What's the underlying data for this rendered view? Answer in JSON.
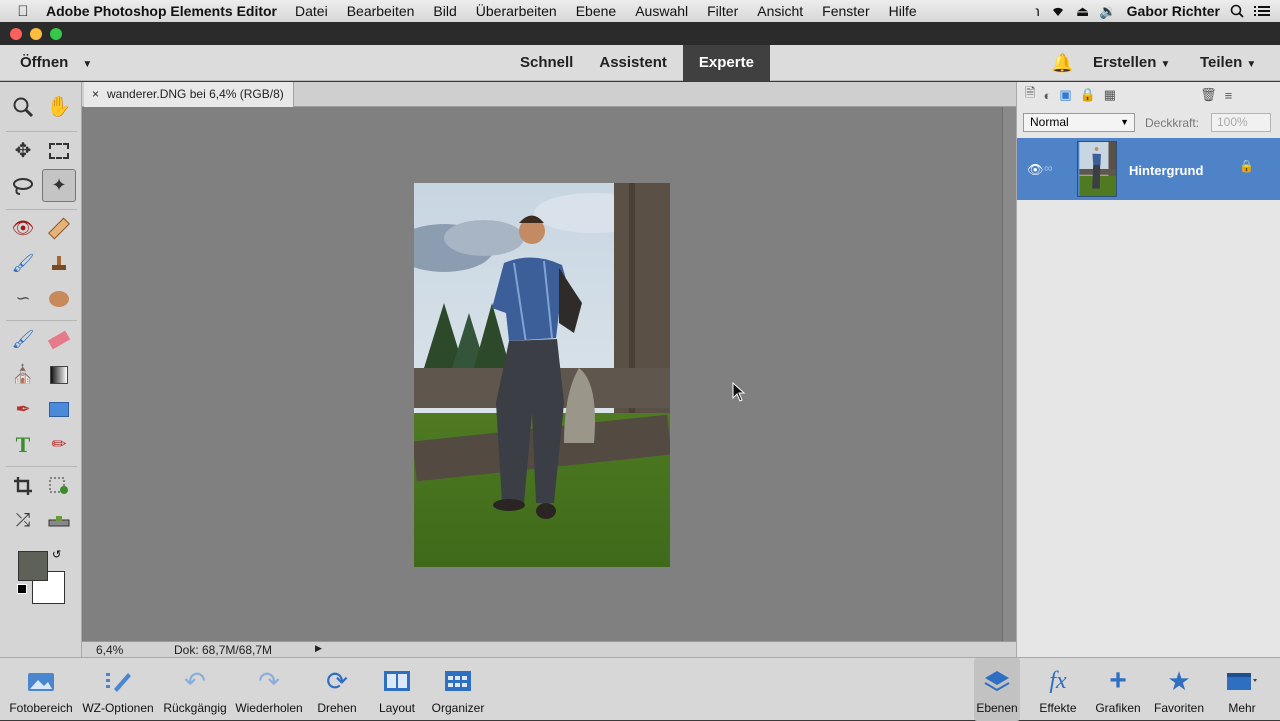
{
  "menubar": {
    "app_name": "Adobe Photoshop Elements Editor",
    "items": [
      "Datei",
      "Bearbeiten",
      "Bild",
      "Überarbeiten",
      "Ebene",
      "Auswahl",
      "Filter",
      "Ansicht",
      "Fenster",
      "Hilfe"
    ],
    "user": "Gabor Richter"
  },
  "topbar": {
    "open_label": "Öffnen",
    "modes": [
      "Schnell",
      "Assistent",
      "Experte"
    ],
    "active_mode": "Experte",
    "create_label": "Erstellen",
    "share_label": "Teilen"
  },
  "document": {
    "tab_close": "×",
    "tab_title": "wanderer.DNG bei 6,4% (RGB/8)",
    "zoom": "6,4%",
    "doc_size": "Dok: 68,7M/68,7M"
  },
  "layers_panel": {
    "blend_mode": "Normal",
    "opacity_label": "Deckkraft:",
    "opacity_value": "100%",
    "layer_name": "Hintergrund"
  },
  "panel_bar": {
    "fotobereich": "Fotobereich",
    "wz_optionen": "WZ-Optionen",
    "rueckgaengig": "Rückgängig",
    "wiederholen": "Wiederholen",
    "drehen": "Drehen",
    "layout": "Layout",
    "organizer": "Organizer",
    "ebenen": "Ebenen",
    "effekte": "Effekte",
    "grafiken": "Grafiken",
    "favoriten": "Favoriten",
    "mehr": "Mehr"
  },
  "colors": {
    "foreground": "#5e6157",
    "background": "#ffffff",
    "accent": "#4f83c7"
  }
}
